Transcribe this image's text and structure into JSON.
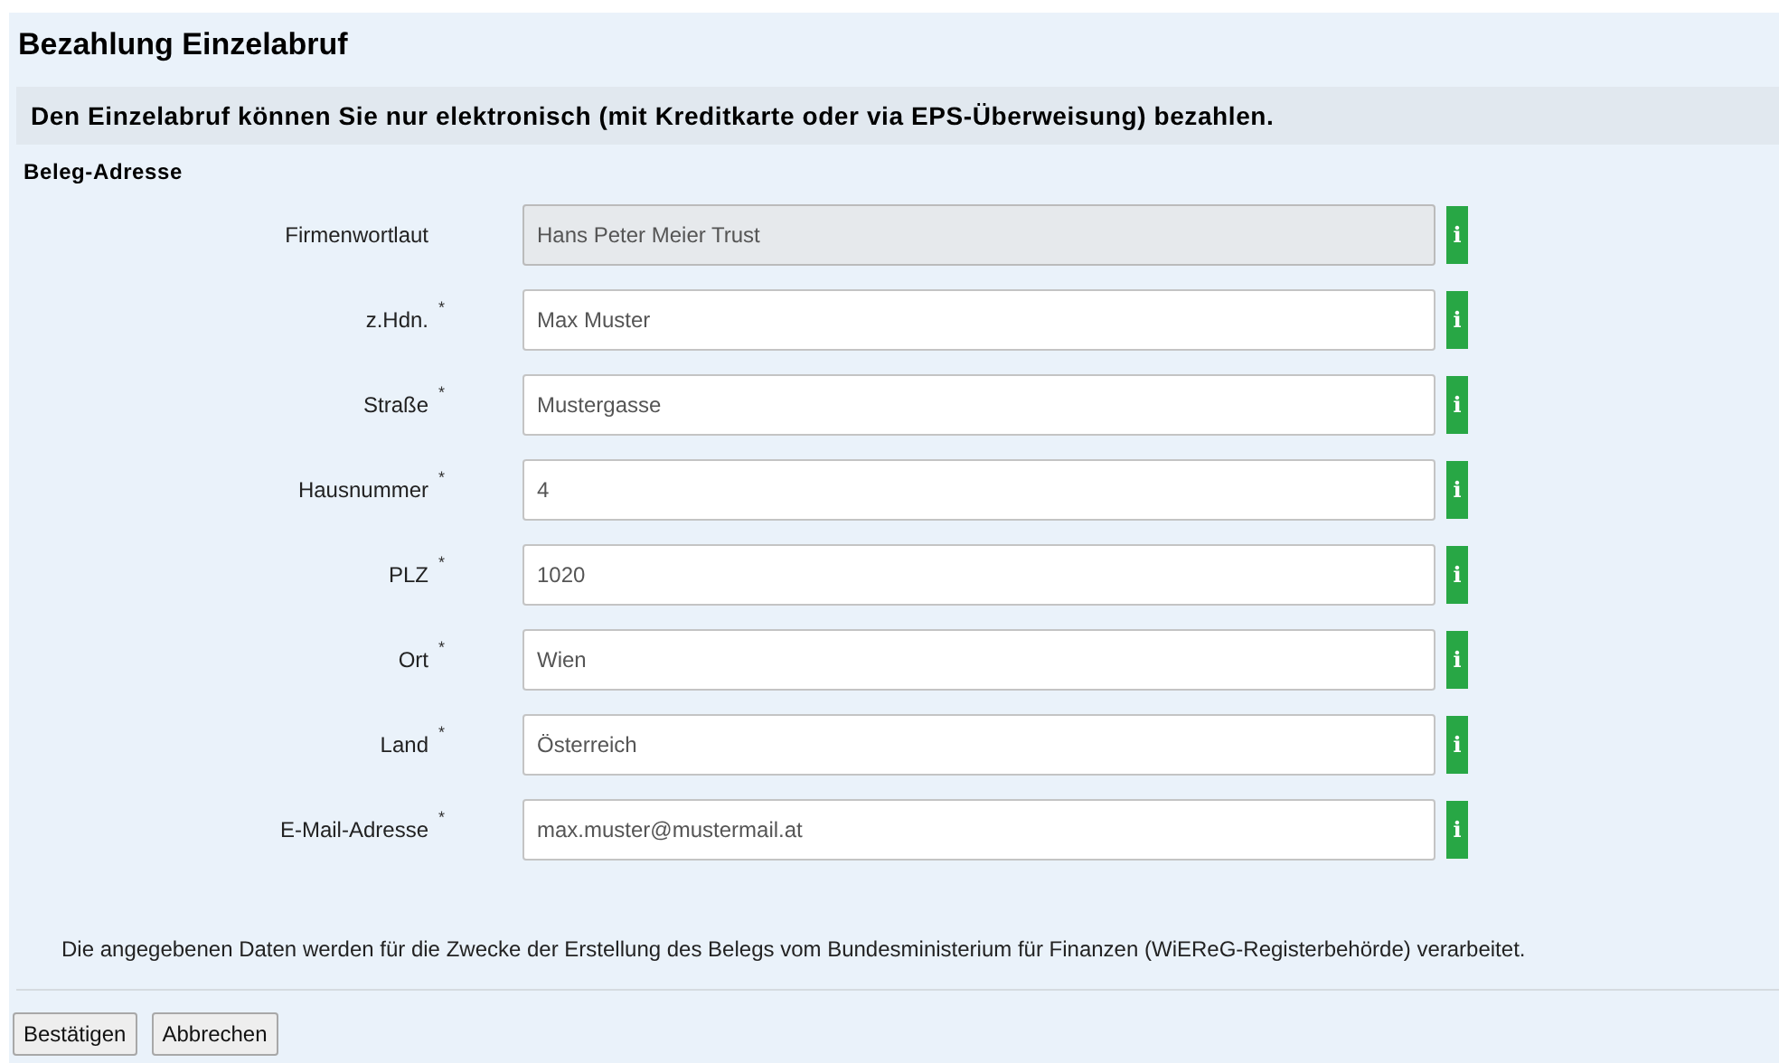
{
  "title": "Bezahlung Einzelabruf",
  "notice": "Den Einzelabruf können Sie nur elektronisch (mit Kreditkarte oder via EPS-Überweisung) bezahlen.",
  "section": "Beleg-Adresse",
  "fields": [
    {
      "label": "Firmenwortlaut",
      "value": "Hans Peter Meier Trust",
      "required": false,
      "disabled": true,
      "info": "i"
    },
    {
      "label": "z.Hdn.",
      "value": "Max Muster",
      "required": true,
      "disabled": false,
      "info": "i"
    },
    {
      "label": "Straße",
      "value": "Mustergasse",
      "required": true,
      "disabled": false,
      "info": "i"
    },
    {
      "label": "Hausnummer",
      "value": "4",
      "required": true,
      "disabled": false,
      "info": "i"
    },
    {
      "label": "PLZ",
      "value": "1020",
      "required": true,
      "disabled": false,
      "info": "i"
    },
    {
      "label": "Ort",
      "value": "Wien",
      "required": true,
      "disabled": false,
      "info": "i"
    },
    {
      "label": "Land",
      "value": "Österreich",
      "required": true,
      "disabled": false,
      "info": "i"
    },
    {
      "label": "E-Mail-Adresse",
      "value": "max.muster@mustermail.at",
      "required": true,
      "disabled": false,
      "info": "i"
    }
  ],
  "required_mark": "*",
  "footnote": "Die angegebenen Daten werden für die Zwecke der Erstellung des Belegs vom Bundesministerium für Finanzen (WiEReG-Registerbehörde) verarbeitet.",
  "buttons": [
    "Bestätigen",
    "Abbrechen"
  ]
}
